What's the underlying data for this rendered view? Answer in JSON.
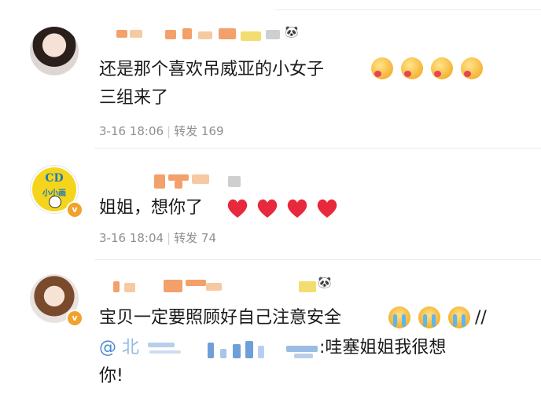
{
  "posts": [
    {
      "text": "还是那个喜欢吊威亚的小女子",
      "text2": "三组来了",
      "time": "3-16 18:06",
      "repost_label": "转发",
      "repost_count": "169"
    },
    {
      "text": "姐姐，想你了",
      "time": "3-16 18:04",
      "repost_label": "转发",
      "repost_count": "74",
      "avatar_text": "CD",
      "avatar_text2": "小小画"
    },
    {
      "text": "宝贝一定要照顾好自己注意安全",
      "slashes": "//",
      "mention_prefix": "@",
      "mention_char": "北",
      "quote_text": ":哇塞姐姐我很想",
      "quote_text2": "你!"
    }
  ],
  "colors": {
    "accent": "#f1a22a",
    "link": "#4d8bd6",
    "meta": "#8f8f8f",
    "heart": "#e8283c"
  }
}
